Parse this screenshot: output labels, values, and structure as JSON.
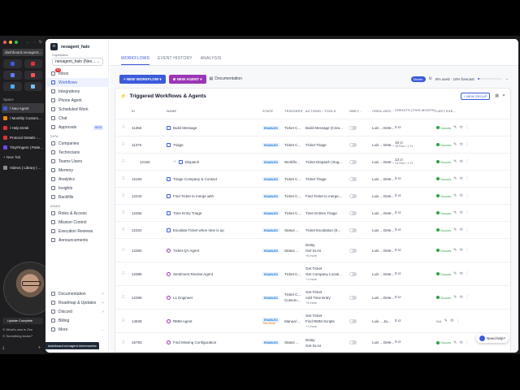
{
  "browser": {
    "url": "dashboard.neoagent...",
    "space_label": "Space",
    "tabs": [
      {
        "label": "/ Neo Agent",
        "active": true,
        "color": "#3b5bdb"
      },
      {
        "label": "/ Monthly Custom...",
        "active": false,
        "color": "#f08c00"
      },
      {
        "label": "/ Help Desk",
        "active": false,
        "color": "#e03131"
      },
      {
        "label": "Protocol Details -...",
        "active": false,
        "color": "#e03131"
      },
      {
        "label": "TinyFingers | Patie...",
        "active": false,
        "color": "#7048e8"
      }
    ],
    "new_tab": "+ New Tab",
    "videos_tab": "Videos | Library | ...",
    "update": "Update Complete",
    "whats_new": "What's new in Zen",
    "something_broke": "Something broke?"
  },
  "app": {
    "brand": "neoagent_halo",
    "org_label": "Organization",
    "org_value": "neoagent_halo (Neo...",
    "nav_main": [
      {
        "label": "Inbox",
        "badge": "10"
      },
      {
        "label": "Workflows",
        "active": true
      },
      {
        "label": "Integrations"
      },
      {
        "label": "Phone Agent"
      },
      {
        "label": "Scheduled Work"
      },
      {
        "label": "Chat"
      },
      {
        "label": "Approvals",
        "tag": "NEW"
      }
    ],
    "section_data": "DATA",
    "nav_data": [
      {
        "label": "Companies"
      },
      {
        "label": "Technicians"
      },
      {
        "label": "Teams Users"
      },
      {
        "label": "Memory"
      },
      {
        "label": "Analytics"
      },
      {
        "label": "Insights"
      },
      {
        "label": "Backfills"
      }
    ],
    "section_admin": "ADMIN",
    "nav_admin": [
      {
        "label": "Roles & Access"
      },
      {
        "label": "Mission Control"
      },
      {
        "label": "Execution Reviews"
      },
      {
        "label": "Announcements"
      }
    ],
    "nav_footer": [
      {
        "label": "Documentation"
      },
      {
        "label": "Roadmap & Updates"
      },
      {
        "label": "Discord"
      },
      {
        "label": "Billing"
      },
      {
        "label": "More"
      }
    ],
    "hover_url": "dashboard.neoagent.io/memories"
  },
  "main": {
    "tabs": [
      "WORKFLOWS",
      "EVENT HISTORY",
      "ANALYSIS"
    ],
    "new_workflow": "+ NEW WORKFLOW",
    "new_agent": "⊕ NEW AGENT",
    "documentation": "Documentation",
    "plan": "Starter",
    "usage": "8% used · 10% forecast",
    "usage_fraction": 0.08,
    "card_title": "Triggered Workflows & Agents",
    "new_group": "+ NEW GROUP",
    "columns": [
      "ID",
      "NAME",
      "STATE",
      "TRIGGERS",
      "ACTIONS / TOOLS",
      "OBEY...",
      "CREA...",
      "DES...",
      "CREDITS (THIS MONTH)",
      "LAST EXE..."
    ],
    "rows": [
      {
        "id": "11356",
        "name": "Build Message",
        "type": "workflow",
        "state": "ENABLED",
        "trigger": "Ticket C...",
        "actions": [
          "Build Message (Crea..."
        ],
        "creator": "Luis ...",
        "desc": "Dete...",
        "credits": "0 cr",
        "credits_sub": "",
        "last": "Succes"
      },
      {
        "id": "11375",
        "name": "Triage",
        "type": "workflow",
        "state": "ENABLED",
        "trigger": "Ticket C...",
        "actions": [
          "Ticket Triage"
        ],
        "creator": "Luis ...",
        "desc": "Dete...",
        "credits": "15 cr",
        "credits_sub": "15 Run / 1 Fr",
        "last": "Succes"
      },
      {
        "id": "12184",
        "name": "Dispatch",
        "type": "workflow",
        "child": true,
        "state": "ENABLED",
        "trigger": "Workflo...",
        "actions": [
          "Ticket Dispatch (Sug..."
        ],
        "creator": "Luis ...",
        "desc": "Dete...",
        "credits": "13 cr",
        "credits_sub": "13 Run / 1 Fr",
        "last": "Succes"
      },
      {
        "id": "12183",
        "name": "Triage Company & Contact",
        "type": "workflow",
        "state": "ENABLED",
        "trigger": "Ticket C...",
        "actions": [
          "Ticket Triage"
        ],
        "creator": "Luis ...",
        "desc": "Dete...",
        "credits": "0 cr",
        "credits_sub": "",
        "last": "Succes"
      },
      {
        "id": "12243",
        "name": "Find Ticket to merge with",
        "type": "workflow",
        "state": "ENABLED",
        "trigger": "Ticket C...",
        "actions": [
          "Find Ticket to merge..."
        ],
        "creator": "Luis ...",
        "desc": "Dete...",
        "credits": "0 cr",
        "credits_sub": "",
        "last": "Succes"
      },
      {
        "id": "12256",
        "name": "Time Entry Triage",
        "type": "workflow",
        "state": "ENABLED",
        "trigger": "Ticket C...",
        "actions": [
          "Time Entries Triage"
        ],
        "creator": "Luis ...",
        "desc": "Dete...",
        "credits": "0 cr",
        "credits_sub": "",
        "last": "Succes"
      },
      {
        "id": "12322",
        "name": "Escalate Ticket when time is up",
        "type": "workflow",
        "state": "ENABLED",
        "trigger": "Status ...",
        "actions": [
          "Ticket Escalation (E..."
        ],
        "creator": "Luis ...",
        "desc": "Dete...",
        "credits": "0 cr",
        "credits_sub": "",
        "last": "Succes"
      },
      {
        "id": "12384",
        "name": "Ticket QA Agent",
        "type": "agent",
        "state": "ENABLED",
        "trigger": "Status ...",
        "actions": [
          "Delay",
          "Get SLAs",
          "+6 more"
        ],
        "creator": "Luis ...",
        "desc": "Dete...",
        "credits": "0 cr",
        "credits_sub": "",
        "last": "Succes"
      },
      {
        "id": "12385",
        "name": "Sentiment Review Agent",
        "type": "agent",
        "state": "ENABLED",
        "trigger": "Ticket C...",
        "actions": [
          "Get Ticket",
          "Get Company Locati...",
          "+1 more"
        ],
        "creator": "Luis ...",
        "desc": "Dete...",
        "credits": "0 cr",
        "credits_sub": "",
        "last": "Succes"
      },
      {
        "id": "12386",
        "name": "L1 Engineer",
        "type": "agent",
        "state": "ENABLED",
        "trigger": "Ticket C... Custom...",
        "actions": [
          "Get Ticket",
          "Add Time Entry",
          "+4 more"
        ],
        "creator": "Luis ...",
        "desc": "Dete...",
        "credits": "0 cr",
        "credits_sub": "",
        "last": "Succes"
      },
      {
        "id": "14828",
        "name": "RMM Agent",
        "type": "agent",
        "state": "ENABLED",
        "state_sub": "Test Mode",
        "trigger": "Manual ...",
        "actions": [
          "Get Ticket",
          "Find RMM Scripts",
          "+7 more"
        ],
        "creator": "Luis ...",
        "desc": "Ja...",
        "credits": "0 cr",
        "credits_sub": "",
        "last": "N/A"
      },
      {
        "id": "16793",
        "name": "Find Missing Configuration",
        "type": "agent",
        "state": "ENABLED",
        "trigger": "Status ...",
        "actions": [
          "Delay",
          "Get SLAs"
        ],
        "creator": "Luis ...",
        "desc": "Dete...",
        "credits": "0 cr",
        "credits_sub": "",
        "last": "Succes"
      }
    ],
    "need_help": "Need help?"
  }
}
